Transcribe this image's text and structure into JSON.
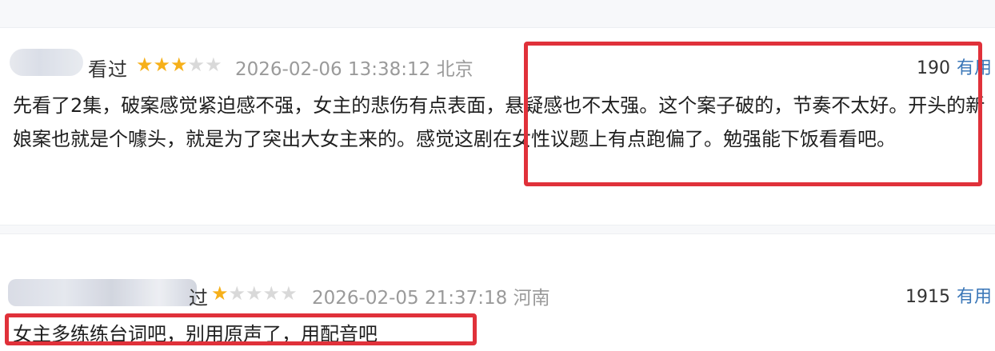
{
  "reviews": [
    {
      "status": "看过",
      "rating": 3,
      "max_rating": 5,
      "date": "2026-02-06 13:38:12",
      "location": "北京",
      "useful_count": "190",
      "useful_label": "有用",
      "content": "先看了2集，破案感觉紧迫感不强，女主的悲伤有点表面，悬疑感也不太强。这个案子破的，节奏不太好。开头的新娘案也就是个噱头，就是为了突出大女主来的。感觉这剧在女性议题上有点跑偏了。勉强能下饭看看吧。"
    },
    {
      "status": "过",
      "rating": 1,
      "max_rating": 5,
      "date": "2026-02-05 21:37:18",
      "location": "河南",
      "useful_count": "1915",
      "useful_label": "有用",
      "content": "女主多练练台词吧，别用原声了，用配音吧"
    }
  ],
  "colors": {
    "star_on": "#f6b01a",
    "star_off": "#d9d9d9",
    "highlight": "#e0313a",
    "useful_link": "#3b77b8"
  },
  "icons": {
    "star_filled": "star-icon",
    "star_empty": "star-outline-icon"
  }
}
